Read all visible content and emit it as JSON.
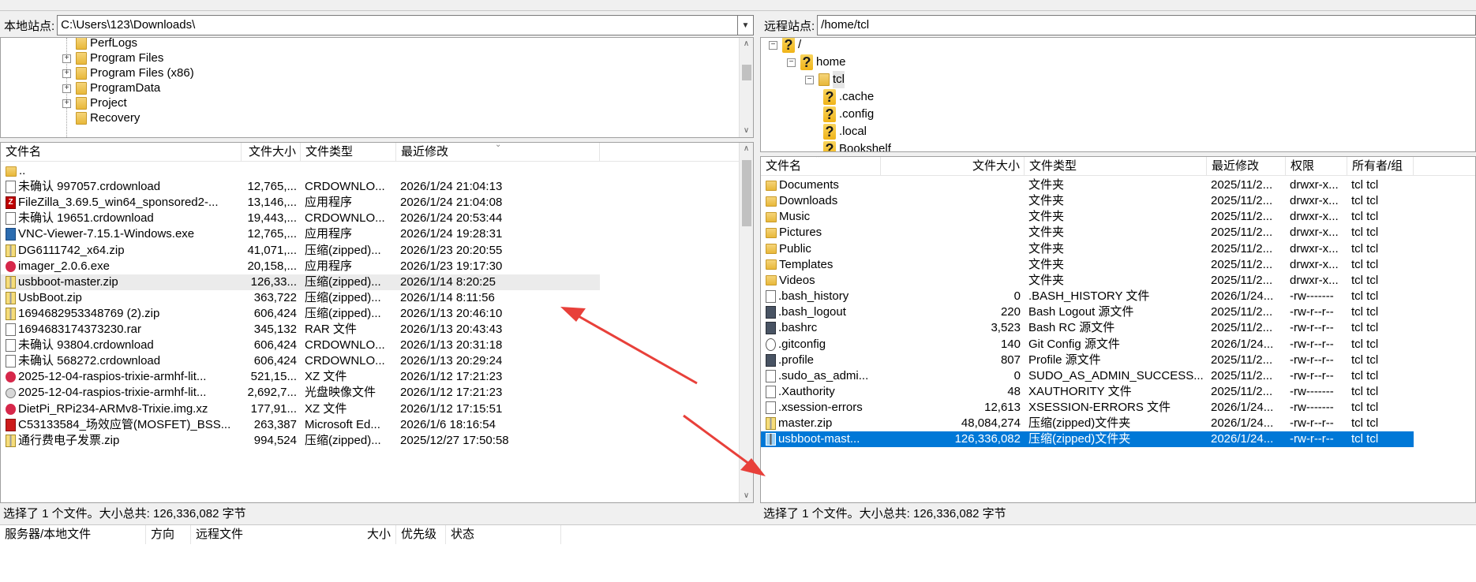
{
  "local": {
    "site_label": "本地站点:",
    "path": "C:\\Users\\123\\Downloads\\",
    "tree": [
      {
        "label": "PerfLogs",
        "expandable": false
      },
      {
        "label": "Program Files",
        "expandable": true
      },
      {
        "label": "Program Files (x86)",
        "expandable": true
      },
      {
        "label": "ProgramData",
        "expandable": true
      },
      {
        "label": "Project",
        "expandable": true
      },
      {
        "label": "Recovery",
        "expandable": false
      }
    ],
    "columns": [
      "文件名",
      "文件大小",
      "文件类型",
      "最近修改"
    ],
    "files": [
      {
        "name": "..",
        "size": "",
        "type": "",
        "modified": "",
        "icon": "folder-icon"
      },
      {
        "name": "未确认 997057.crdownload",
        "size": "12,765,...",
        "type": "CRDOWNLO...",
        "modified": "2026/1/24 21:04:13",
        "icon": "document-icon"
      },
      {
        "name": "FileZilla_3.69.5_win64_sponsored2-...",
        "size": "13,146,...",
        "type": "应用程序",
        "modified": "2026/1/24 21:04:08",
        "icon": "filezilla-icon"
      },
      {
        "name": "未确认 19651.crdownload",
        "size": "19,443,...",
        "type": "CRDOWNLO...",
        "modified": "2026/1/24 20:53:44",
        "icon": "document-icon"
      },
      {
        "name": "VNC-Viewer-7.15.1-Windows.exe",
        "size": "12,765,...",
        "type": "应用程序",
        "modified": "2026/1/24 19:28:31",
        "icon": "vnc-icon"
      },
      {
        "name": "DG6111742_x64.zip",
        "size": "41,071,...",
        "type": "压缩(zipped)...",
        "modified": "2026/1/23 20:20:55",
        "icon": "zip-icon"
      },
      {
        "name": "imager_2.0.6.exe",
        "size": "20,158,...",
        "type": "应用程序",
        "modified": "2026/1/23 19:17:30",
        "icon": "raspberry-icon"
      },
      {
        "name": "usbboot-master.zip",
        "size": "126,33...",
        "type": "压缩(zipped)...",
        "modified": "2026/1/14 8:20:25",
        "icon": "zip-icon"
      },
      {
        "name": "UsbBoot.zip",
        "size": "363,722",
        "type": "压缩(zipped)...",
        "modified": "2026/1/14 8:11:56",
        "icon": "zip-icon"
      },
      {
        "name": "1694682953348769 (2).zip",
        "size": "606,424",
        "type": "压缩(zipped)...",
        "modified": "2026/1/13 20:46:10",
        "icon": "zip-icon"
      },
      {
        "name": "1694683174373230.rar",
        "size": "345,132",
        "type": "RAR 文件",
        "modified": "2026/1/13 20:43:43",
        "icon": "document-icon"
      },
      {
        "name": "未确认 93804.crdownload",
        "size": "606,424",
        "type": "CRDOWNLO...",
        "modified": "2026/1/13 20:31:18",
        "icon": "document-icon"
      },
      {
        "name": "未确认 568272.crdownload",
        "size": "606,424",
        "type": "CRDOWNLO...",
        "modified": "2026/1/13 20:29:24",
        "icon": "document-icon"
      },
      {
        "name": "2025-12-04-raspios-trixie-armhf-lit...",
        "size": "521,15...",
        "type": "XZ 文件",
        "modified": "2026/1/12 17:21:23",
        "icon": "raspberry-icon"
      },
      {
        "name": "2025-12-04-raspios-trixie-armhf-lit...",
        "size": "2,692,7...",
        "type": "光盘映像文件",
        "modified": "2026/1/12 17:21:23",
        "icon": "disc-image-icon"
      },
      {
        "name": "DietPi_RPi234-ARMv8-Trixie.img.xz",
        "size": "177,91...",
        "type": "XZ 文件",
        "modified": "2026/1/12 17:15:51",
        "icon": "raspberry-icon"
      },
      {
        "name": "C53133584_场效应管(MOSFET)_BSS...",
        "size": "263,387",
        "type": "Microsoft Ed...",
        "modified": "2026/1/6 18:16:54",
        "icon": "pdf-icon"
      },
      {
        "name": "通行费电子发票.zip",
        "size": "994,524",
        "type": "压缩(zipped)...",
        "modified": "2025/12/27 17:50:58",
        "icon": "zip-icon"
      }
    ],
    "status": "选择了 1 个文件。大小总共: 126,336,082 字节"
  },
  "remote": {
    "site_label": "远程站点:",
    "path": "/home/tcl",
    "tree": [
      {
        "label": "/",
        "depth": 0
      },
      {
        "label": "home",
        "depth": 1
      },
      {
        "label": "tcl",
        "depth": 2
      },
      {
        "label": ".cache",
        "depth": 3
      },
      {
        "label": ".config",
        "depth": 3
      },
      {
        "label": ".local",
        "depth": 3
      },
      {
        "label": "Bookshelf",
        "depth": 3
      }
    ],
    "columns": [
      "文件名",
      "文件大小",
      "文件类型",
      "最近修改",
      "权限",
      "所有者/组"
    ],
    "files": [
      {
        "name": "Documents",
        "size": "",
        "type": "文件夹",
        "modified": "2025/11/2...",
        "perm": "drwxr-x...",
        "owner": "tcl tcl",
        "icon": "folder-icon"
      },
      {
        "name": "Downloads",
        "size": "",
        "type": "文件夹",
        "modified": "2025/11/2...",
        "perm": "drwxr-x...",
        "owner": "tcl tcl",
        "icon": "folder-icon"
      },
      {
        "name": "Music",
        "size": "",
        "type": "文件夹",
        "modified": "2025/11/2...",
        "perm": "drwxr-x...",
        "owner": "tcl tcl",
        "icon": "folder-icon"
      },
      {
        "name": "Pictures",
        "size": "",
        "type": "文件夹",
        "modified": "2025/11/2...",
        "perm": "drwxr-x...",
        "owner": "tcl tcl",
        "icon": "folder-icon"
      },
      {
        "name": "Public",
        "size": "",
        "type": "文件夹",
        "modified": "2025/11/2...",
        "perm": "drwxr-x...",
        "owner": "tcl tcl",
        "icon": "folder-icon"
      },
      {
        "name": "Templates",
        "size": "",
        "type": "文件夹",
        "modified": "2025/11/2...",
        "perm": "drwxr-x...",
        "owner": "tcl tcl",
        "icon": "folder-icon"
      },
      {
        "name": "Videos",
        "size": "",
        "type": "文件夹",
        "modified": "2025/11/2...",
        "perm": "drwxr-x...",
        "owner": "tcl tcl",
        "icon": "folder-icon"
      },
      {
        "name": ".bash_history",
        "size": "0",
        "type": ".BASH_HISTORY 文件",
        "modified": "2026/1/24...",
        "perm": "-rw-------",
        "owner": "tcl tcl",
        "icon": "document-icon"
      },
      {
        "name": ".bash_logout",
        "size": "220",
        "type": "Bash Logout 源文件",
        "modified": "2025/11/2...",
        "perm": "-rw-r--r--",
        "owner": "tcl tcl",
        "icon": "script-icon"
      },
      {
        "name": ".bashrc",
        "size": "3,523",
        "type": "Bash RC 源文件",
        "modified": "2025/11/2...",
        "perm": "-rw-r--r--",
        "owner": "tcl tcl",
        "icon": "script-icon"
      },
      {
        "name": ".gitconfig",
        "size": "140",
        "type": "Git Config 源文件",
        "modified": "2026/1/24...",
        "perm": "-rw-r--r--",
        "owner": "tcl tcl",
        "icon": "gear-icon"
      },
      {
        "name": ".profile",
        "size": "807",
        "type": "Profile 源文件",
        "modified": "2025/11/2...",
        "perm": "-rw-r--r--",
        "owner": "tcl tcl",
        "icon": "script-icon"
      },
      {
        "name": ".sudo_as_admi...",
        "size": "0",
        "type": "SUDO_AS_ADMIN_SUCCESS...",
        "modified": "2025/11/2...",
        "perm": "-rw-r--r--",
        "owner": "tcl tcl",
        "icon": "document-icon"
      },
      {
        "name": ".Xauthority",
        "size": "48",
        "type": "XAUTHORITY 文件",
        "modified": "2025/11/2...",
        "perm": "-rw-------",
        "owner": "tcl tcl",
        "icon": "document-icon"
      },
      {
        "name": ".xsession-errors",
        "size": "12,613",
        "type": "XSESSION-ERRORS 文件",
        "modified": "2026/1/24...",
        "perm": "-rw-------",
        "owner": "tcl tcl",
        "icon": "document-icon"
      },
      {
        "name": "master.zip",
        "size": "48,084,274",
        "type": "压缩(zipped)文件夹",
        "modified": "2026/1/24...",
        "perm": "-rw-r--r--",
        "owner": "tcl tcl",
        "icon": "zip-icon"
      },
      {
        "name": "usbboot-mast...",
        "size": "126,336,082",
        "type": "压缩(zipped)文件夹",
        "modified": "2026/1/24...",
        "perm": "-rw-r--r--",
        "owner": "tcl tcl",
        "icon": "zip-icon"
      }
    ],
    "status": "选择了 1 个文件。大小总共: 126,336,082 字节"
  },
  "queue": {
    "columns": [
      "服务器/本地文件",
      "方向",
      "远程文件",
      "大小",
      "优先级",
      "状态"
    ]
  },
  "colors": {
    "selection_blue": "#0078d7",
    "annotation_red": "#e8403a"
  }
}
